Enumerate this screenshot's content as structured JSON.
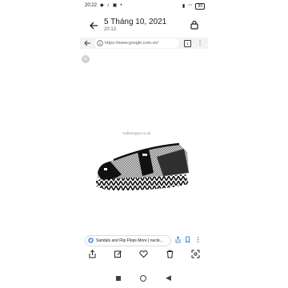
{
  "status_bar": {
    "time": "20:22",
    "battery": "89"
  },
  "header": {
    "title": "5 Tháng 10, 2021",
    "subtitle": "20:13"
  },
  "browser": {
    "url": "https://www.google.com.vn/",
    "tabs_count": "1"
  },
  "image": {
    "watermark": "walkersgun.co.uk"
  },
  "link": {
    "text": "Sandals and Flip Flops More | nucle..."
  },
  "icons": {
    "back": "arrow-left-icon",
    "lock": "lock-icon",
    "close": "close-icon",
    "google": "google-icon",
    "share": "share-icon",
    "edit": "edit-icon",
    "favorite": "heart-icon",
    "delete": "trash-icon",
    "lens": "lens-icon"
  }
}
